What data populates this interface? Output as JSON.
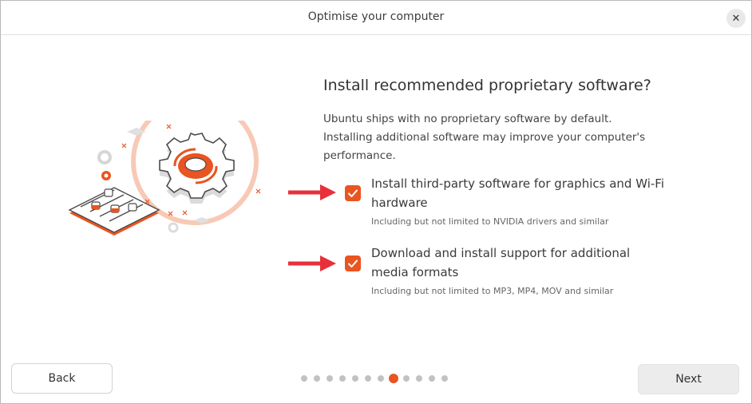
{
  "window": {
    "title": "Optimise your computer",
    "close_icon": "close-icon"
  },
  "content": {
    "heading": "Install recommended proprietary software?",
    "description": "Ubuntu ships with no proprietary software by default. Installing additional software may improve your computer's performance.",
    "options": [
      {
        "label": "Install third-party software for graphics and Wi-Fi hardware",
        "sublabel": "Including but not limited to NVIDIA drivers and similar",
        "checked": true
      },
      {
        "label": "Download and install support for additional media formats",
        "sublabel": "Including but not limited to MP3, MP4, MOV and similar",
        "checked": true
      }
    ]
  },
  "footer": {
    "back_label": "Back",
    "next_label": "Next",
    "pager": {
      "total": 12,
      "current": 8
    }
  },
  "colors": {
    "accent": "#e95420",
    "arrow": "#e8303a"
  }
}
